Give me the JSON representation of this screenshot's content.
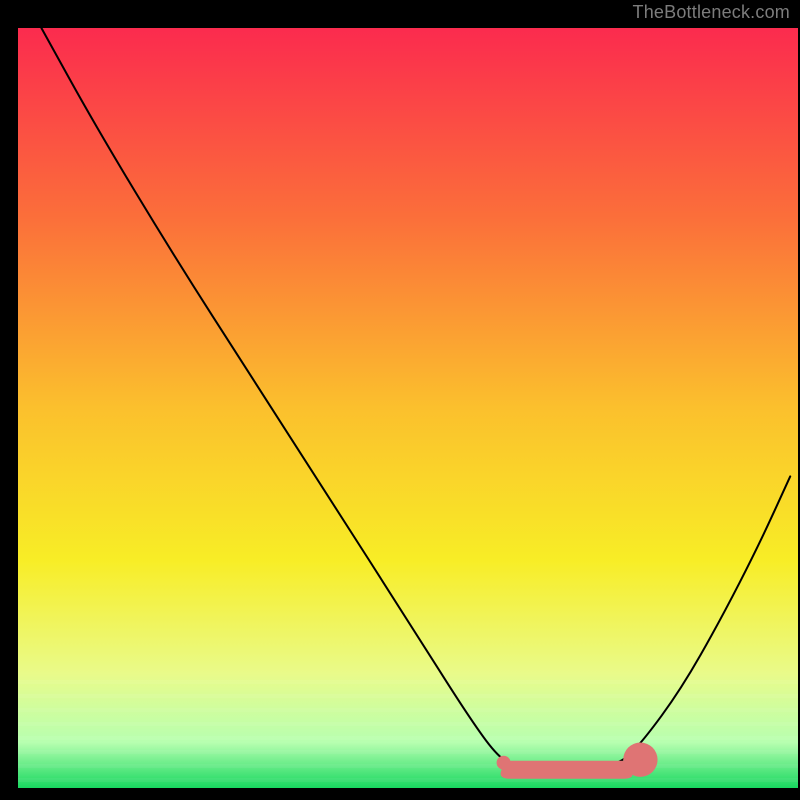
{
  "watermark": "TheBottleneck.com",
  "chart_data": {
    "type": "line",
    "title": "",
    "xlabel": "",
    "ylabel": "",
    "xlim": [
      0,
      100
    ],
    "ylim": [
      0,
      100
    ],
    "axes_visible": false,
    "background": "vertical-gradient",
    "gradient_stops": [
      {
        "offset": 0.0,
        "color": "#fb2b4e"
      },
      {
        "offset": 0.25,
        "color": "#fb6f3a"
      },
      {
        "offset": 0.5,
        "color": "#fbc02d"
      },
      {
        "offset": 0.7,
        "color": "#f8ed26"
      },
      {
        "offset": 0.85,
        "color": "#e9fb8a"
      },
      {
        "offset": 0.94,
        "color": "#b7ffb0"
      },
      {
        "offset": 1.0,
        "color": "#18d860"
      }
    ],
    "series": [
      {
        "name": "bottleneck-curve",
        "stroke": "#000000",
        "stroke_width": 2,
        "points": [
          {
            "x": 3.0,
            "y": 100.0
          },
          {
            "x": 10.0,
            "y": 87.0
          },
          {
            "x": 20.0,
            "y": 70.0
          },
          {
            "x": 30.0,
            "y": 54.0
          },
          {
            "x": 40.0,
            "y": 38.0
          },
          {
            "x": 50.0,
            "y": 22.0
          },
          {
            "x": 58.0,
            "y": 9.0
          },
          {
            "x": 62.0,
            "y": 3.5
          },
          {
            "x": 65.0,
            "y": 2.5
          },
          {
            "x": 72.0,
            "y": 2.5
          },
          {
            "x": 77.0,
            "y": 3.0
          },
          {
            "x": 80.0,
            "y": 6.0
          },
          {
            "x": 85.0,
            "y": 13.0
          },
          {
            "x": 90.0,
            "y": 22.0
          },
          {
            "x": 95.0,
            "y": 32.0
          },
          {
            "x": 99.0,
            "y": 41.0
          }
        ]
      }
    ],
    "plateau_marker": {
      "comment": "pink/coral rounded bar marking the flat minimum region",
      "color": "#df7474",
      "x_start": 62.0,
      "x_end": 78.0,
      "y": 2.8,
      "thickness": 3.2,
      "end_dot": {
        "x": 78.0,
        "y": 3.2,
        "r": 1.6
      }
    }
  }
}
